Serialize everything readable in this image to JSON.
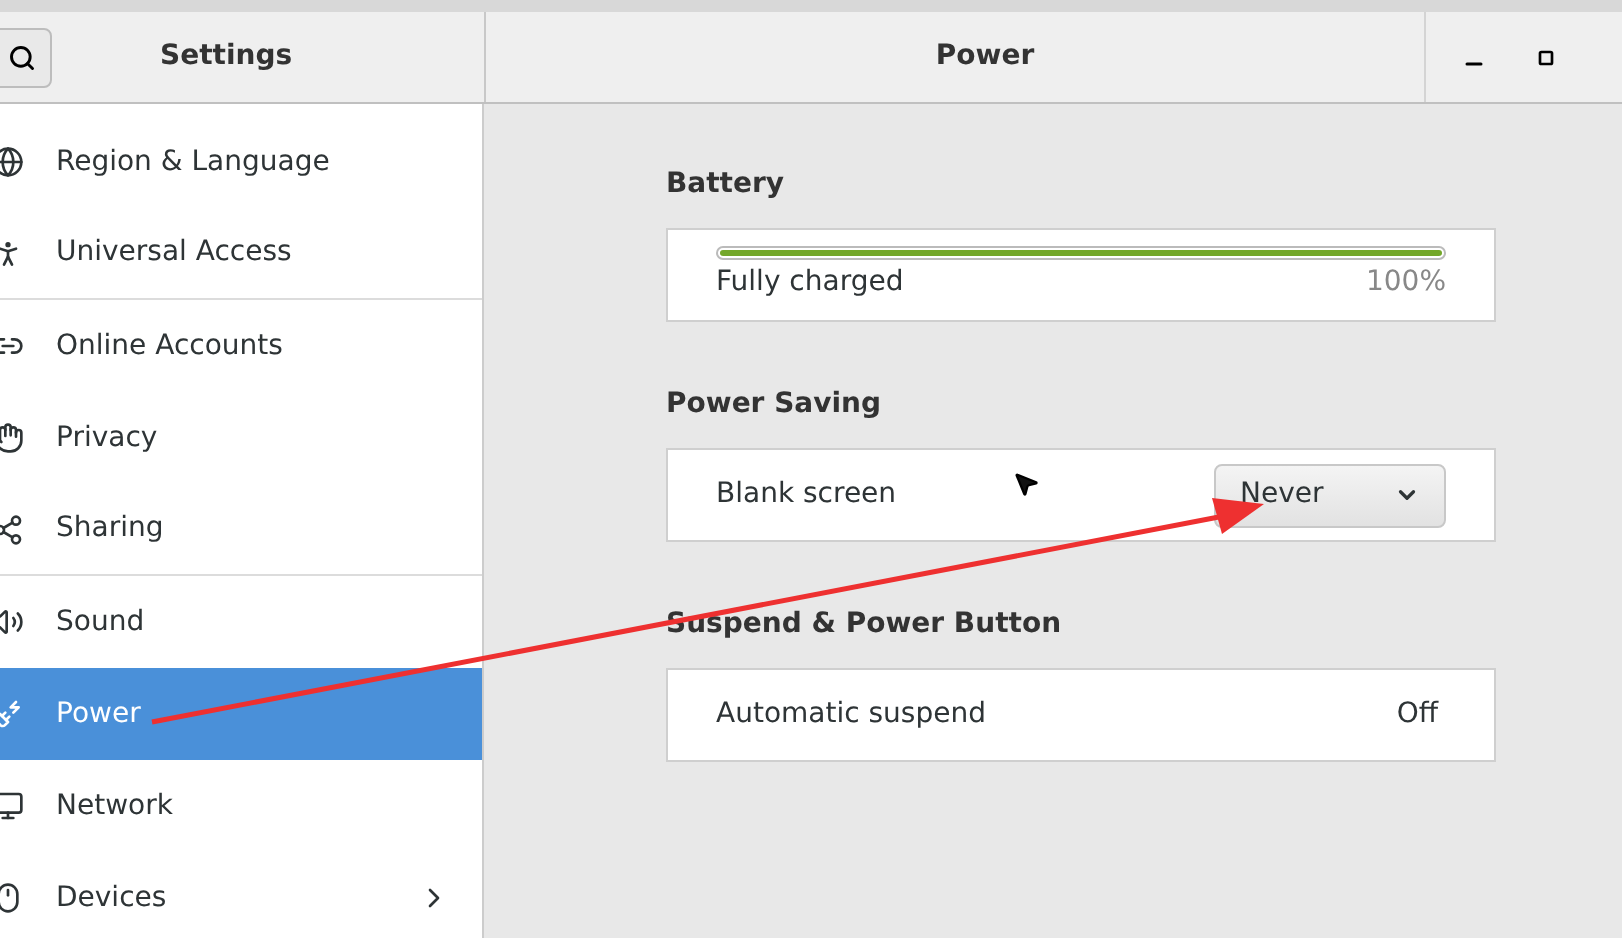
{
  "header": {
    "left_title": "Settings",
    "title": "Power"
  },
  "sidebar": {
    "items": [
      {
        "label": "Region & Language",
        "selected": false,
        "divider_below": false,
        "has_children": false
      },
      {
        "label": "Universal Access",
        "selected": false,
        "divider_below": true,
        "has_children": false
      },
      {
        "label": "Online Accounts",
        "selected": false,
        "divider_below": false,
        "has_children": false
      },
      {
        "label": "Privacy",
        "selected": false,
        "divider_below": false,
        "has_children": false
      },
      {
        "label": "Sharing",
        "selected": false,
        "divider_below": true,
        "has_children": false
      },
      {
        "label": "Sound",
        "selected": false,
        "divider_below": false,
        "has_children": false
      },
      {
        "label": "Power",
        "selected": true,
        "divider_below": false,
        "has_children": false
      },
      {
        "label": "Network",
        "selected": false,
        "divider_below": false,
        "has_children": false
      },
      {
        "label": "Devices",
        "selected": false,
        "divider_below": false,
        "has_children": true
      }
    ]
  },
  "sections": [
    {
      "title": "Battery",
      "rows": [
        {
          "kind": "battery",
          "label": "Fully charged",
          "value": "100%",
          "level": 1.0
        }
      ]
    },
    {
      "title": "Power Saving",
      "rows": [
        {
          "kind": "dropdown",
          "label": "Blank screen",
          "value": "Never"
        }
      ]
    },
    {
      "title": "Suspend & Power Button",
      "rows": [
        {
          "kind": "value",
          "label": "Automatic suspend",
          "value": "Off"
        }
      ]
    }
  ]
}
